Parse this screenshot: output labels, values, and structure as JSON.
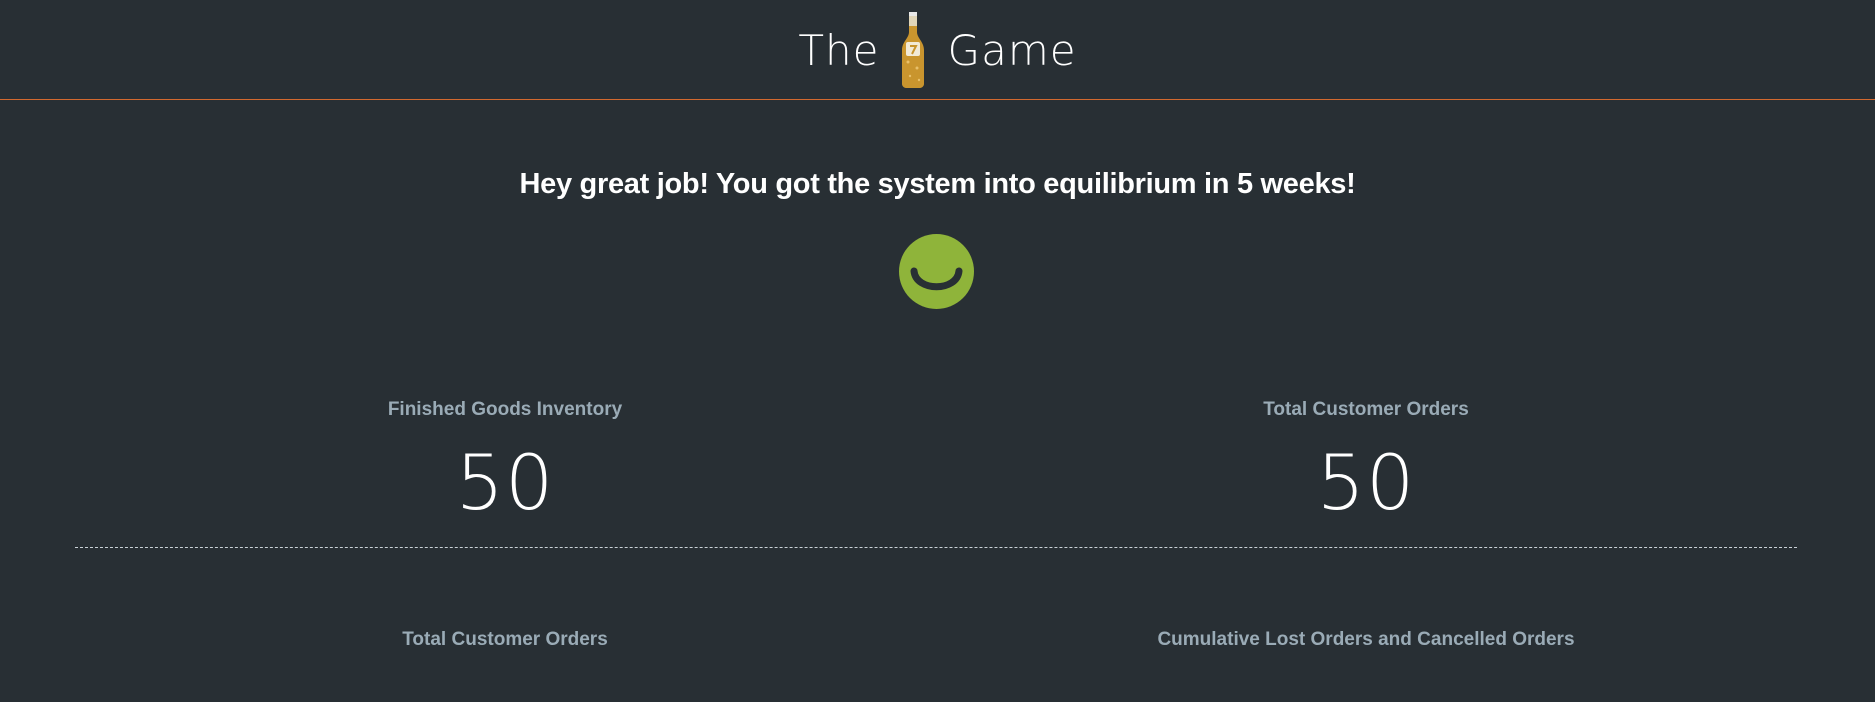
{
  "header": {
    "title_left": "The",
    "title_right": "Game",
    "logo_icon": "beer-bottle-icon",
    "accent_color": "#d2692f"
  },
  "result": {
    "message": "Hey great job! You got the system into equilibrium in 5 weeks!",
    "status_icon": "smiley-face-icon",
    "status_color": "#8fb43a"
  },
  "stats_top": [
    {
      "label": "Finished Goods Inventory",
      "value": "50"
    },
    {
      "label": "Total Customer Orders",
      "value": "50"
    }
  ],
  "stats_bottom": [
    {
      "label": "Total Customer Orders"
    },
    {
      "label": "Cumulative Lost Orders and Cancelled Orders"
    }
  ]
}
